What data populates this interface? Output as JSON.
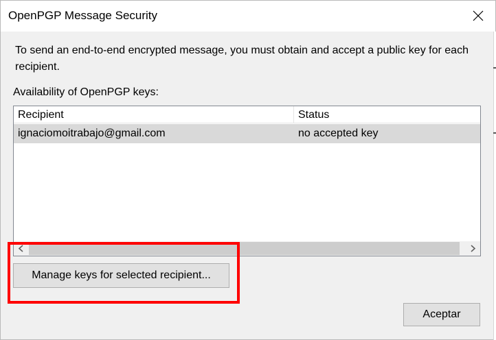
{
  "window": {
    "title": "OpenPGP Message Security"
  },
  "titlebar": {
    "close_icon": "close-icon"
  },
  "dialog": {
    "description": "To send an end-to-end encrypted message, you must obtain and accept a public key for each recipient.",
    "availability_label": "Availability of OpenPGP keys:"
  },
  "keys_table": {
    "columns": [
      "Recipient",
      "Status"
    ],
    "rows": [
      {
        "recipient": "ignaciomoitrabajo@gmail.com",
        "status": "no accepted key"
      }
    ],
    "scroll_left_icon": "chevron-left-icon",
    "scroll_right_icon": "chevron-right-icon"
  },
  "buttons": {
    "manage_keys": "Manage keys for selected recipient...",
    "accept": "Aceptar"
  },
  "colors": {
    "highlight": "#ff0000",
    "selected_row": "#d9d9d9",
    "button_face": "#e1e1e1"
  }
}
